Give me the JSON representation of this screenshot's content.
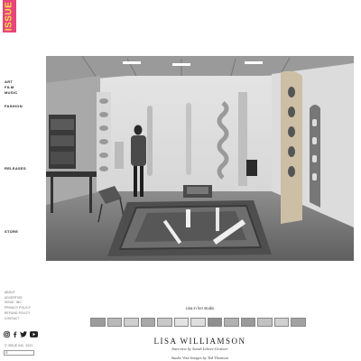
{
  "logo": {
    "text": "ISSUE"
  },
  "nav": {
    "top": [
      "ART",
      "FILM",
      "MUSIC"
    ],
    "fashion": "FASHION",
    "releases": "RELEASES",
    "store": "STORE"
  },
  "footer_links": [
    "ABOUT",
    "ADVERTISE",
    "ISSUE, INC.",
    "PRIVACY POLICY",
    "REFUND POLICY",
    "CONTACT"
  ],
  "social_icons": [
    "instagram-icon",
    "facebook-icon",
    "twitter-icon",
    "youtube-icon"
  ],
  "copyright": "© ISSUE INC. 2021",
  "search": {
    "placeholder": ""
  },
  "article": {
    "caption": "Lisa in her studio",
    "title": "LISA WILLIAMSON",
    "byline": "Interview by Sarah Lehrer-Graiwer",
    "credit": "Studio Visit Images by Ted Thomson"
  },
  "gallery": {
    "thumbnail_count": 13
  },
  "colors": {
    "logo_bg": "#e8457a",
    "logo_text": "#f4e04d"
  }
}
